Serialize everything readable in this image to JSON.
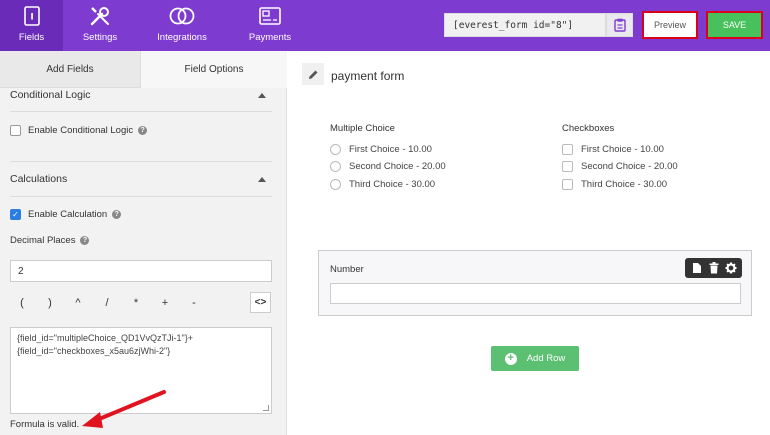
{
  "nav": {
    "fields": "Fields",
    "settings": "Settings",
    "integrations": "Integrations",
    "payments": "Payments"
  },
  "header": {
    "shortcode": "[everest_form id=\"8\"]",
    "preview": "Preview",
    "save": "SAVE"
  },
  "panel": {
    "tab_add": "Add Fields",
    "tab_options": "Field Options",
    "conditional_title": "Conditional Logic",
    "conditional_checkbox": "Enable Conditional Logic",
    "calculations_title": "Calculations",
    "enable_calculation": "Enable Calculation",
    "decimal_label": "Decimal Places",
    "decimal_value": "2",
    "operators": [
      "(",
      ")",
      "^",
      "/",
      "*",
      "+",
      "-"
    ],
    "code_btn": "<>",
    "formula_line1": "{field_id=\"multipleChoice_QD1VvQzTJi-1\"}+",
    "formula_line2": "{field_id=\"checkboxes_x5au6zjWhi-2\"}",
    "valid_message": "Formula is valid."
  },
  "form": {
    "title": "payment form",
    "mc_title": "Multiple Choice",
    "mc_options": [
      "First Choice - 10.00",
      "Second Choice - 20.00",
      "Third Choice - 30.00"
    ],
    "cb_title": "Checkboxes",
    "cb_options": [
      "First Choice - 10.00",
      "Second Choice - 20.00",
      "Third Choice - 30.00"
    ],
    "number_label": "Number",
    "add_row": "Add Row"
  },
  "colors": {
    "topbar": "#7e3bd0",
    "save": "#47c15b",
    "highlight": "#d9001b",
    "add_row": "#5cc073"
  }
}
